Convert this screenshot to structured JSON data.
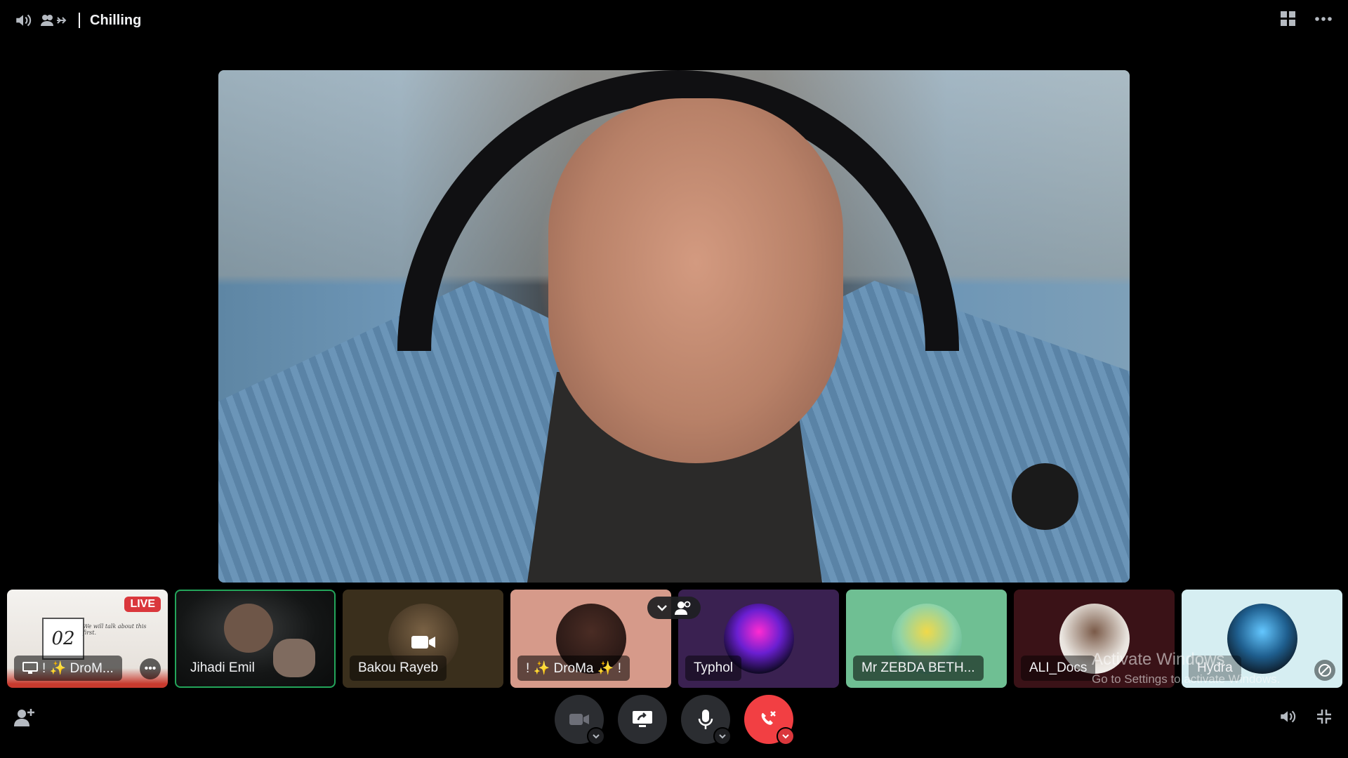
{
  "header": {
    "channel_title": "Chilling"
  },
  "participants": [
    {
      "name": "! ✨ DroM...",
      "live_label": "LIVE",
      "screen_text_day": "02",
      "screen_text": "We will talk about this first."
    },
    {
      "name": "Jihadi Emil"
    },
    {
      "name": "Bakou Rayeb"
    },
    {
      "name": "! ✨ DroMa ✨ !"
    },
    {
      "name": "Typhol"
    },
    {
      "name": "Mr ZEBDA BETH..."
    },
    {
      "name": "ALI_Docs"
    },
    {
      "name": "Hydra"
    }
  ],
  "watermark": {
    "line1": "Activate Windows",
    "line2": "Go to Settings to activate Windows."
  },
  "colors": {
    "background": "#000000",
    "control_button": "#2b2d31",
    "hangup": "#f23f43",
    "live_badge": "#da373c",
    "speaking_outline": "#23a55a"
  },
  "icons": {
    "top_left": [
      "speaker-icon",
      "voice-members-icon"
    ],
    "top_right": [
      "grid-layout-icon",
      "more-options-icon"
    ],
    "controls": [
      "camera-icon",
      "screen-share-icon",
      "microphone-icon",
      "hang-up-icon"
    ],
    "bottom_left": [
      "invite-user-icon"
    ],
    "bottom_right": [
      "volume-icon",
      "exit-fullscreen-icon"
    ]
  }
}
